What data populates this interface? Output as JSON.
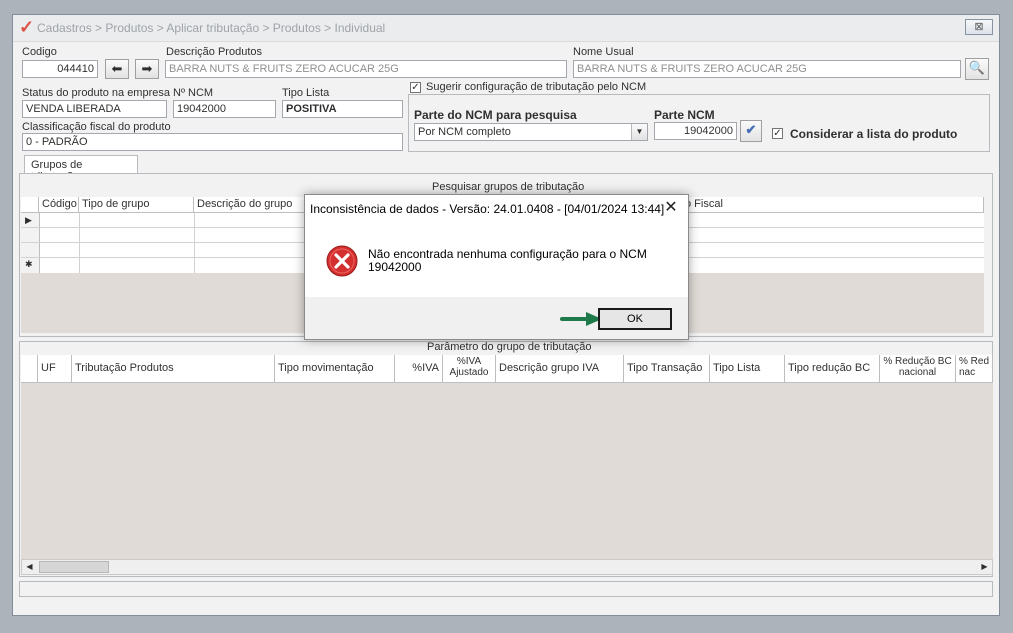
{
  "window": {
    "breadcrumb": "Cadastros > Produtos > Aplicar tributação > Produtos > Individual",
    "close_glyph": "⊠"
  },
  "form": {
    "codigo_label": "Codigo",
    "codigo_value": "044410",
    "descricao_label": "Descrição Produtos",
    "descricao_value": "BARRA NUTS & FRUITS ZERO ACUCAR 25G",
    "nome_usual_label": "Nome Usual",
    "nome_usual_value": "BARRA NUTS & FRUITS ZERO ACUCAR 25G",
    "status_label": "Status do produto na empresa",
    "status_value": "VENDA LIBERADA",
    "ncm_label": "Nº NCM",
    "ncm_value": "19042000",
    "tipo_lista_label": "Tipo Lista",
    "tipo_lista_value": "POSITIVA",
    "classif_label": "Classificação fiscal do produto",
    "classif_value": "0 - PADRÃO",
    "sugerir_label": "Sugerir configuração de tributação pelo NCM",
    "parte_ncm_pesquisa_label": "Parte do NCM para pesquisa",
    "parte_ncm_pesquisa_value": "Por NCM completo",
    "parte_ncm_label": "Parte NCM",
    "parte_ncm_value": "19042000",
    "considerar_label": "Considerar a lista do produto"
  },
  "tabs": {
    "grupos": "Grupos de tributação"
  },
  "grid1": {
    "title": "Pesquisar grupos de tributação",
    "columns": [
      "Código",
      "Tipo de grupo",
      "Descrição do grupo",
      "o Fiscal"
    ]
  },
  "grid2": {
    "title": "Parâmetro do grupo de tributação",
    "columns": [
      "UF",
      "Tributação Produtos",
      "Tipo movimentação",
      "%IVA",
      "%IVA Ajustado",
      "Descrição grupo IVA",
      "Tipo Transação",
      "Tipo Lista",
      "Tipo redução BC",
      "% Redução BC nacional",
      "% Red nac"
    ]
  },
  "dialog": {
    "title": "Inconsistência de dados - Versão: 24.01.0408 - [04/01/2024 13:44]",
    "message": "Não encontrada nenhuma configuração para o NCM 19042000",
    "ok": "OK",
    "close_glyph": "✕"
  },
  "colors": {
    "arrow": "#1e7a4a",
    "error": "#d32f2f"
  }
}
